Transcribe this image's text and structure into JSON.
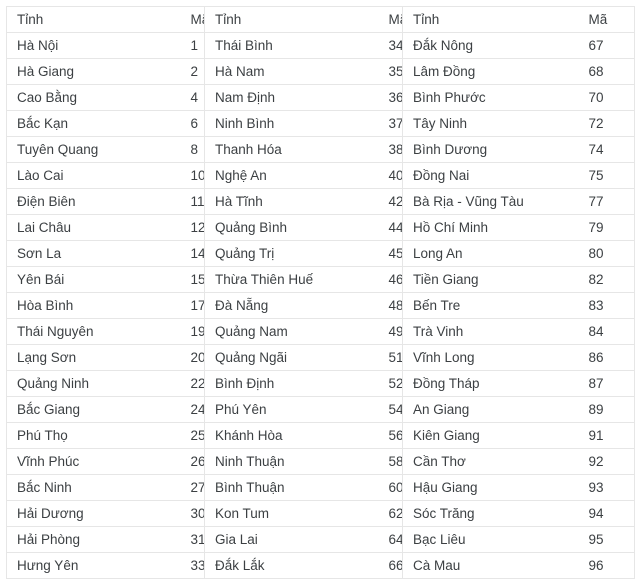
{
  "table": {
    "name": "vietnam-province-codes",
    "headers": [
      "Tỉnh",
      "Mã",
      "Tỉnh",
      "Mã",
      "Tỉnh",
      "Mã"
    ],
    "rows": [
      [
        "Hà Nội",
        "1",
        "Thái Bình",
        "34",
        "Đắk Nông",
        "67"
      ],
      [
        "Hà Giang",
        "2",
        "Hà Nam",
        "35",
        "Lâm Đồng",
        "68"
      ],
      [
        "Cao Bằng",
        "4",
        "Nam Định",
        "36",
        "Bình Phước",
        "70"
      ],
      [
        "Bắc Kạn",
        "6",
        "Ninh Bình",
        "37",
        "Tây Ninh",
        "72"
      ],
      [
        "Tuyên Quang",
        "8",
        "Thanh Hóa",
        "38",
        "Bình Dương",
        "74"
      ],
      [
        "Lào Cai",
        "10",
        "Nghệ An",
        "40",
        "Đồng Nai",
        "75"
      ],
      [
        "Điện Biên",
        "11",
        "Hà Tĩnh",
        "42",
        "Bà Rịa - Vũng Tàu",
        "77"
      ],
      [
        "Lai Châu",
        "12",
        "Quảng Bình",
        "44",
        "Hồ Chí Minh",
        "79"
      ],
      [
        "Sơn La",
        "14",
        "Quảng Trị",
        "45",
        "Long An",
        "80"
      ],
      [
        "Yên Bái",
        "15",
        "Thừa Thiên Huế",
        "46",
        "Tiền Giang",
        "82"
      ],
      [
        "Hòa Bình",
        "17",
        "Đà Nẵng",
        "48",
        "Bến Tre",
        "83"
      ],
      [
        "Thái Nguyên",
        "19",
        "Quảng Nam",
        "49",
        "Trà Vinh",
        "84"
      ],
      [
        "Lạng Sơn",
        "20",
        "Quảng Ngãi",
        "51",
        "Vĩnh Long",
        "86"
      ],
      [
        "Quảng Ninh",
        "22",
        "Bình Định",
        "52",
        "Đồng Tháp",
        "87"
      ],
      [
        "Bắc Giang",
        "24",
        "Phú Yên",
        "54",
        "An Giang",
        "89"
      ],
      [
        "Phú Thọ",
        "25",
        "Khánh Hòa",
        "56",
        "Kiên Giang",
        "91"
      ],
      [
        "Vĩnh Phúc",
        "26",
        "Ninh Thuận",
        "58",
        "Cần Thơ",
        "92"
      ],
      [
        "Bắc Ninh",
        "27",
        "Bình Thuận",
        "60",
        "Hậu Giang",
        "93"
      ],
      [
        "Hải Dương",
        "30",
        "Kon Tum",
        "62",
        "Sóc Trăng",
        "94"
      ],
      [
        "Hải Phòng",
        "31",
        "Gia Lai",
        "64",
        "Bạc Liêu",
        "95"
      ],
      [
        "Hưng Yên",
        "33",
        "Đắk Lắk",
        "66",
        "Cà Mau",
        "96"
      ]
    ]
  },
  "colors": {
    "text": "#3c4043",
    "border": "#e6e6e6",
    "background": "#ffffff"
  }
}
